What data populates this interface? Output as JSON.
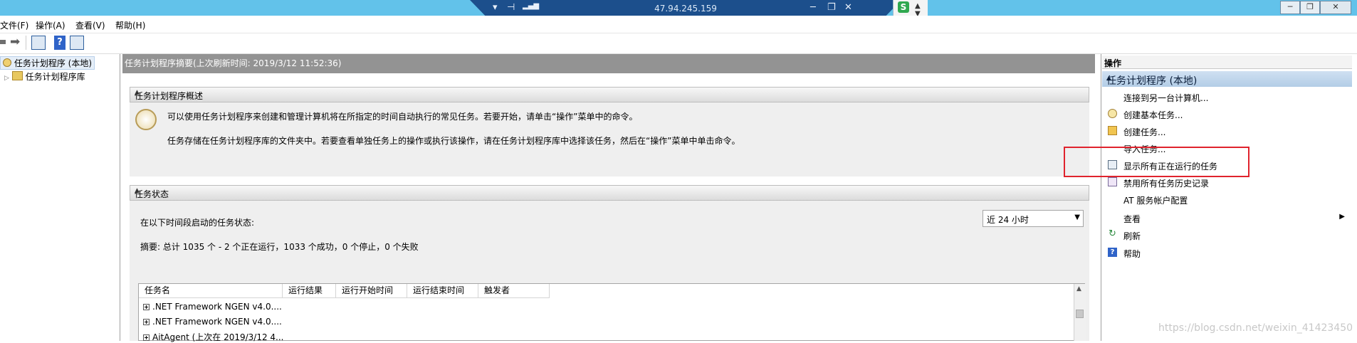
{
  "remote_bar": {
    "ip": "47.94.245.159"
  },
  "menubar": {
    "items": [
      "文件(F)",
      "操作(A)",
      "查看(V)",
      "帮助(H)"
    ]
  },
  "tree": {
    "root": "任务计划程序 (本地)",
    "child": "任务计划程序库"
  },
  "center": {
    "title": "任务计划程序摘要(上次刷新时间: 2019/3/12 11:52:36)",
    "overview": {
      "header": "任务计划程序概述",
      "line1": "可以使用任务计划程序来创建和管理计算机将在所指定的时间自动执行的常见任务。若要开始，请单击“操作”菜单中的命令。",
      "line2": "任务存储在任务计划程序库的文件夹中。若要查看单独任务上的操作或执行该操作，请在任务计划程序库中选择该任务，然后在“操作”菜单中单击命令。"
    },
    "status": {
      "header": "任务状态",
      "prompt": "在以下时间段启动的任务状态:",
      "period": "近 24 小时",
      "summary": "摘要: 总计 1035 个 - 2 个正在运行，1033 个成功，0 个停止，0 个失败"
    },
    "table": {
      "columns": [
        "任务名",
        "运行结果",
        "运行开始时间",
        "运行结束时间",
        "触发者"
      ],
      "rows": [
        ".NET Framework NGEN v4.0....",
        ".NET Framework NGEN v4.0....",
        "AitAgent (上次在 2019/3/12 4..."
      ]
    }
  },
  "actions": {
    "header": "操作",
    "section": "任务计划程序 (本地)",
    "items": [
      {
        "label": "连接到另一台计算机...",
        "icon": "none"
      },
      {
        "label": "创建基本任务...",
        "icon": "clock-wizard-icon"
      },
      {
        "label": "创建任务...",
        "icon": "task-create-icon"
      },
      {
        "label": "导入任务...",
        "icon": "none"
      },
      {
        "label": "显示所有正在运行的任务",
        "icon": "running-tasks-icon"
      },
      {
        "label": "禁用所有任务历史记录",
        "icon": "history-icon"
      },
      {
        "label": "AT 服务帐户配置",
        "icon": "none"
      },
      {
        "label": "查看",
        "icon": "none"
      },
      {
        "label": "刷新",
        "icon": "refresh-icon"
      },
      {
        "label": "帮助",
        "icon": "help-icon"
      }
    ]
  },
  "watermark": "https://blog.csdn.net/weixin_41423450",
  "colors": {
    "titlebar": "#62c2ea",
    "remote_bar": "#1c4f8c",
    "highlight": "#e0232d",
    "action_section": "#c2d7ee"
  }
}
